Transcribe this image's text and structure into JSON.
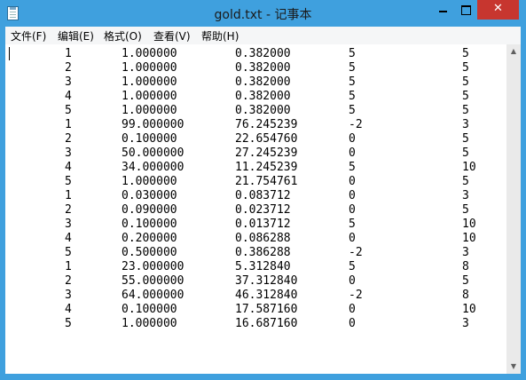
{
  "window": {
    "title": "gold.txt - 记事本",
    "controls": {
      "minimize": "",
      "maximize": "",
      "close": "✕"
    }
  },
  "menu": [
    {
      "label": "文件(F)"
    },
    {
      "label": "编辑(E)"
    },
    {
      "label": "格式(O)"
    },
    {
      "label": "查看(V)"
    },
    {
      "label": "帮助(H)"
    }
  ],
  "rows": [
    [
      "1",
      "1.000000",
      "0.382000",
      "5",
      "5"
    ],
    [
      "2",
      "1.000000",
      "0.382000",
      "5",
      "5"
    ],
    [
      "3",
      "1.000000",
      "0.382000",
      "5",
      "5"
    ],
    [
      "4",
      "1.000000",
      "0.382000",
      "5",
      "5"
    ],
    [
      "5",
      "1.000000",
      "0.382000",
      "5",
      "5"
    ],
    [
      "1",
      "99.000000",
      "76.245239",
      "-2",
      "3"
    ],
    [
      "2",
      "0.100000",
      "22.654760",
      "0",
      "5"
    ],
    [
      "3",
      "50.000000",
      "27.245239",
      "0",
      "5"
    ],
    [
      "4",
      "34.000000",
      "11.245239",
      "5",
      "10"
    ],
    [
      "5",
      "1.000000",
      "21.754761",
      "0",
      "5"
    ],
    [
      "1",
      "0.030000",
      "0.083712",
      "0",
      "3"
    ],
    [
      "2",
      "0.090000",
      "0.023712",
      "0",
      "5"
    ],
    [
      "3",
      "0.100000",
      "0.013712",
      "5",
      "10"
    ],
    [
      "4",
      "0.200000",
      "0.086288",
      "0",
      "10"
    ],
    [
      "5",
      "0.500000",
      "0.386288",
      "-2",
      "3"
    ],
    [
      "1",
      "23.000000",
      "5.312840",
      "5",
      "8"
    ],
    [
      "2",
      "55.000000",
      "37.312840",
      "0",
      "5"
    ],
    [
      "3",
      "64.000000",
      "46.312840",
      "-2",
      "8"
    ],
    [
      "4",
      "0.100000",
      "17.587160",
      "0",
      "10"
    ],
    [
      "5",
      "1.000000",
      "16.687160",
      "0",
      "3"
    ]
  ],
  "colors": {
    "titlebar": "#3fa0de",
    "close_button": "#c7362f",
    "menubar": "#f5f6f7"
  },
  "icons": {
    "app": "notepad-icon",
    "scroll_up": "triangle-up-icon",
    "scroll_down": "triangle-down-icon"
  }
}
